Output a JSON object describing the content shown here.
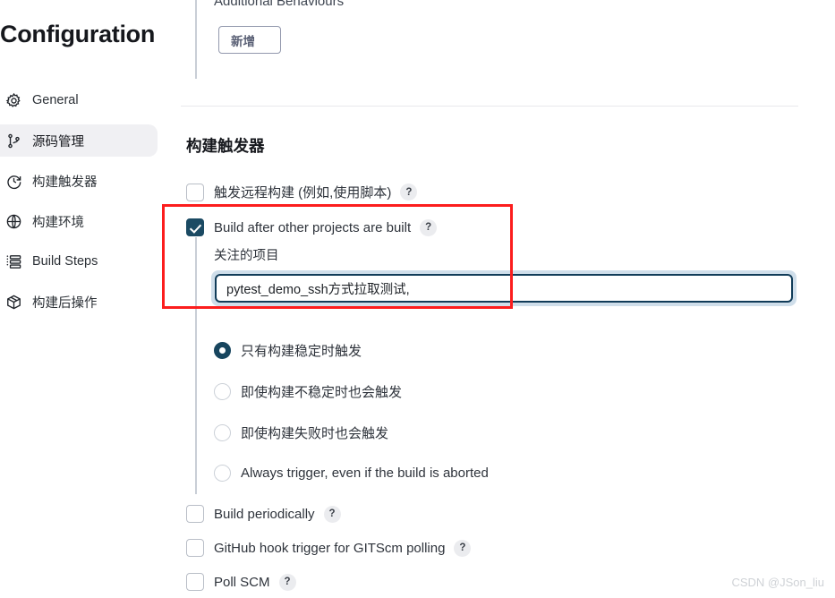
{
  "sidebar": {
    "title": "Configuration",
    "items": [
      {
        "label": "General",
        "icon": "gear-icon",
        "active": false
      },
      {
        "label": "源码管理",
        "icon": "git-branch-icon",
        "active": true
      },
      {
        "label": "构建触发器",
        "icon": "clock-icon",
        "active": false
      },
      {
        "label": "构建环境",
        "icon": "globe-icon",
        "active": false
      },
      {
        "label": "Build Steps",
        "icon": "list-steps-icon",
        "active": false
      },
      {
        "label": "构建后操作",
        "icon": "package-box-icon",
        "active": false
      }
    ]
  },
  "main": {
    "additional_behaviours_label": "Additional Behaviours",
    "add_button_label": "新增",
    "section_title": "构建触发器",
    "triggers": [
      {
        "label": "触发远程构建 (例如,使用脚本)",
        "checked": false,
        "help": "?"
      },
      {
        "label": "Build after other projects are built",
        "checked": true,
        "help": "?"
      }
    ],
    "watched_projects_label": "关注的项目",
    "project_input": {
      "value": "pytest_demo_ssh方式拉取测试,",
      "placeholder": ""
    },
    "threshold_options": [
      {
        "label": "只有构建稳定时触发",
        "selected": true
      },
      {
        "label": "即使构建不稳定时也会触发",
        "selected": false
      },
      {
        "label": "即使构建失败时也会触发",
        "selected": false
      },
      {
        "label": "Always trigger, even if the build is aborted",
        "selected": false
      }
    ],
    "bottom_triggers": [
      {
        "label": "Build periodically",
        "checked": false,
        "help": "?"
      },
      {
        "label": "GitHub hook trigger for GITScm polling",
        "checked": false,
        "help": "?"
      },
      {
        "label": "Poll SCM",
        "checked": false,
        "help": "?"
      }
    ]
  },
  "watermark": "CSDN @JSon_liu",
  "colors": {
    "accent_dark": "#17455e",
    "highlight_red": "#fc1d1d",
    "focus_ring": "#cfdeea",
    "active_nav_bg": "#f0f0f3"
  }
}
